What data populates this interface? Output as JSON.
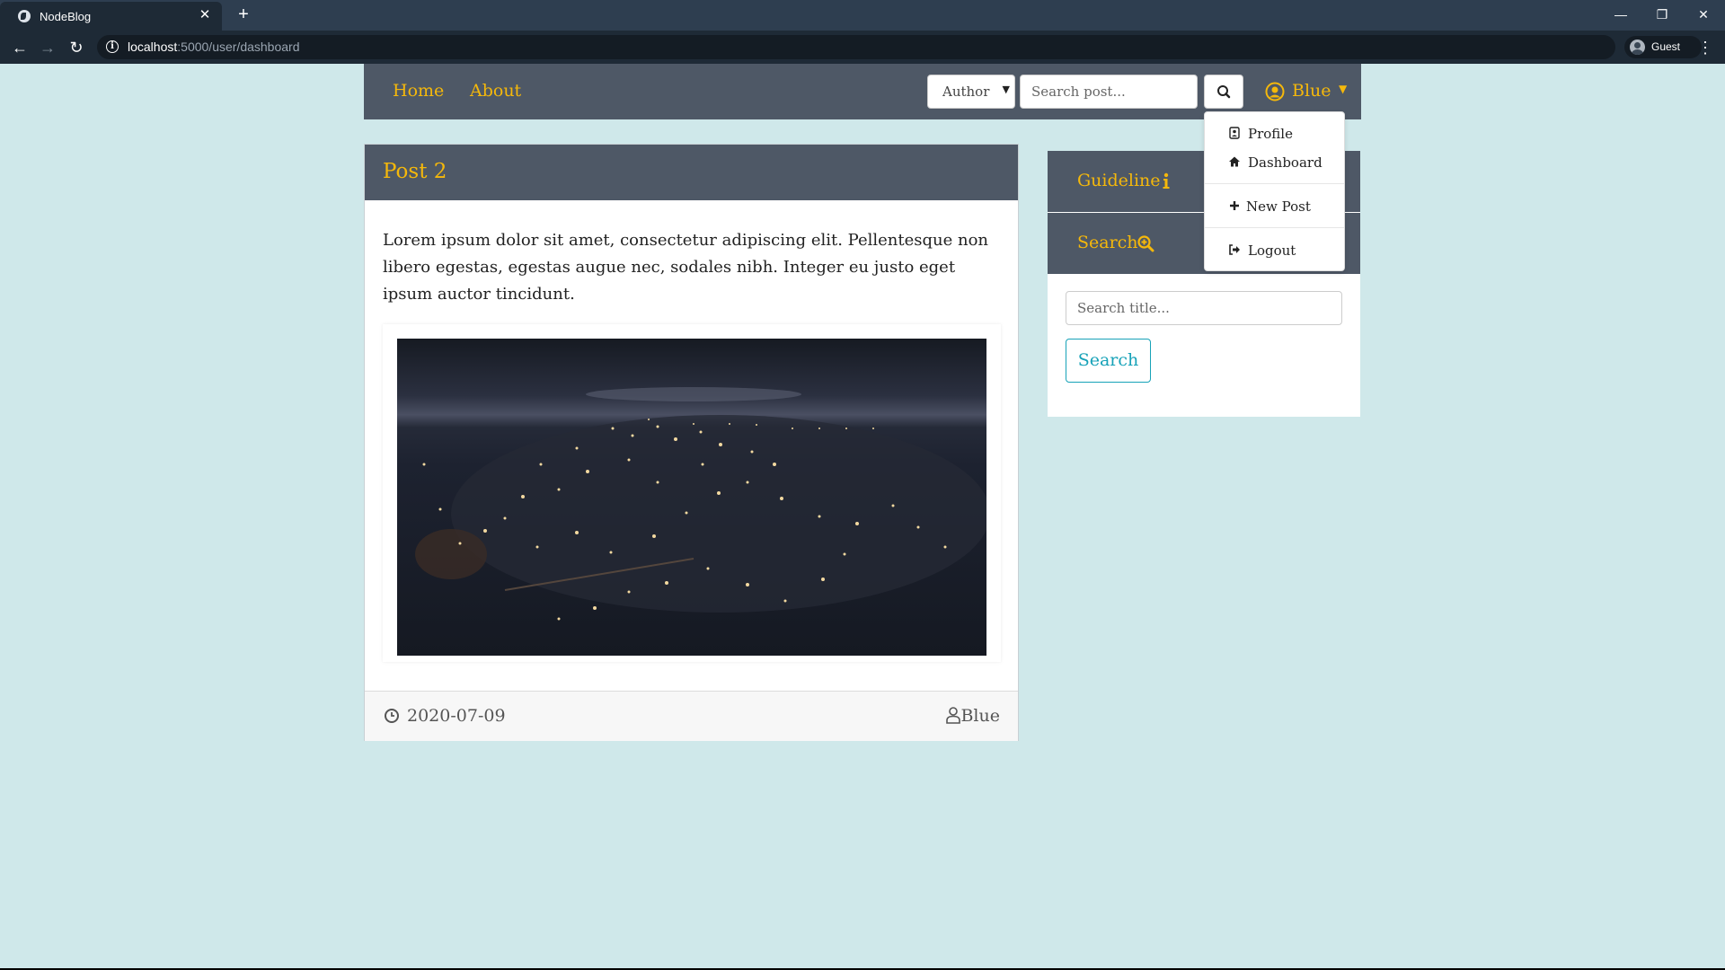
{
  "browser": {
    "tab_title": "NodeBlog",
    "url_host": "localhost",
    "url_path": ":5000/user/dashboard",
    "profile_name": "Guest"
  },
  "nav": {
    "links": [
      "Home",
      "About"
    ],
    "author_select": "Author",
    "search_placeholder": "Search post...",
    "user_name": "Blue"
  },
  "user_menu": {
    "items": [
      "Profile",
      "Dashboard",
      "New Post",
      "Logout"
    ]
  },
  "post": {
    "title": "Post 2",
    "body": "Lorem ipsum dolor sit amet, consectetur adipiscing elit. Pellentesque non libero egestas, egestas augue nec, sodales nibh. Integer eu justo eget ipsum auctor tincidunt.",
    "date": "2020-07-09",
    "author": "Blue"
  },
  "sidebar": {
    "guideline_title": "Guideline",
    "search_title": "Search",
    "search_placeholder": "Search title...",
    "search_button": "Search"
  },
  "colors": {
    "accent": "#f5b80b",
    "header_bg": "#4e5866",
    "page_bg": "#cfe8ea",
    "button_teal": "#17a2b8"
  }
}
